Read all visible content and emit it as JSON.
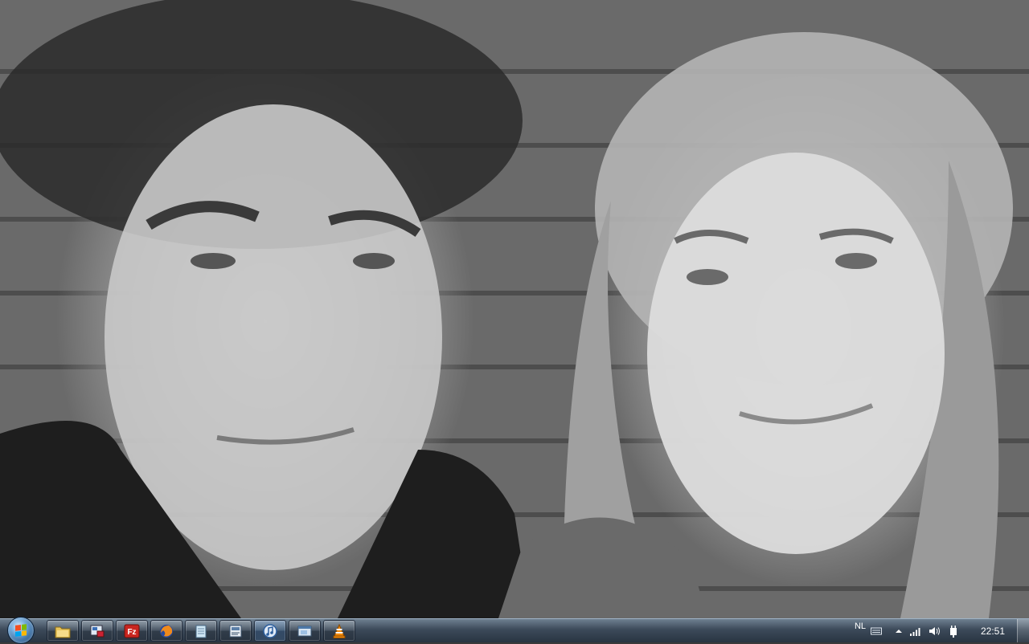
{
  "desktop": {
    "wallpaper_description_icon": "photo-wallpaper"
  },
  "taskbar": {
    "start_icon": "windows-orb-icon",
    "pinned": [
      {
        "name": "explorer",
        "icon": "folder-icon"
      },
      {
        "name": "settings",
        "icon": "control-panel-icon"
      },
      {
        "name": "filezilla",
        "icon": "filezilla-icon",
        "glyph": "Fz"
      },
      {
        "name": "firefox",
        "icon": "firefox-icon"
      },
      {
        "name": "notepad",
        "icon": "notepad-icon"
      },
      {
        "name": "document",
        "icon": "document-icon"
      },
      {
        "name": "itunes",
        "icon": "itunes-icon"
      },
      {
        "name": "window",
        "icon": "window-icon"
      },
      {
        "name": "vlc",
        "icon": "vlc-icon"
      }
    ],
    "tray": {
      "language": "NL",
      "clock": "22:51"
    },
    "colors": {
      "taskbar": "#2e3c4c",
      "accent": "#6fa7d8"
    }
  }
}
